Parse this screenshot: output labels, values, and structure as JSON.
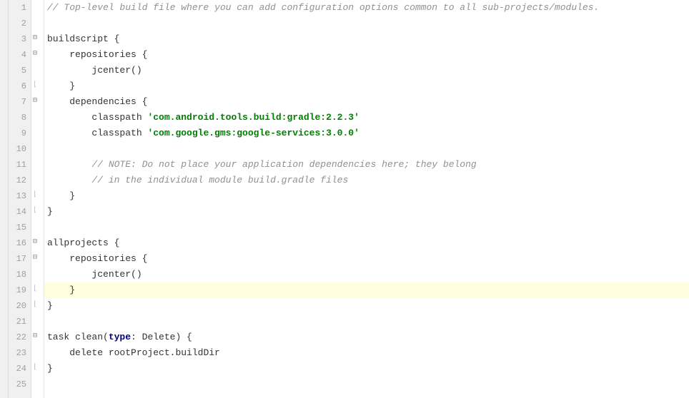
{
  "editor": {
    "highlighted_line": 19,
    "line_count": 25,
    "lines": [
      {
        "n": 1,
        "segs": [
          {
            "t": "// Top-level build file where you can add configuration options common to all sub-projects/modules.",
            "cls": "comment"
          }
        ],
        "indent": 0
      },
      {
        "n": 2,
        "segs": [],
        "indent": 0
      },
      {
        "n": 3,
        "segs": [
          {
            "t": "buildscript {",
            "cls": "ident"
          }
        ],
        "indent": 0,
        "fold": "open"
      },
      {
        "n": 4,
        "segs": [
          {
            "t": "repositories {",
            "cls": "ident"
          }
        ],
        "indent": 1,
        "fold": "open"
      },
      {
        "n": 5,
        "segs": [
          {
            "t": "jcenter()",
            "cls": "ident"
          }
        ],
        "indent": 2
      },
      {
        "n": 6,
        "segs": [
          {
            "t": "}",
            "cls": "ident"
          }
        ],
        "indent": 1,
        "fold": "close"
      },
      {
        "n": 7,
        "segs": [
          {
            "t": "dependencies {",
            "cls": "ident"
          }
        ],
        "indent": 1,
        "fold": "open"
      },
      {
        "n": 8,
        "segs": [
          {
            "t": "classpath ",
            "cls": "ident"
          },
          {
            "t": "'com.android.tools.build:gradle:2.2.3'",
            "cls": "string"
          }
        ],
        "indent": 2
      },
      {
        "n": 9,
        "segs": [
          {
            "t": "classpath ",
            "cls": "ident"
          },
          {
            "t": "'com.google.gms:google-services:3.0.0'",
            "cls": "string"
          }
        ],
        "indent": 2
      },
      {
        "n": 10,
        "segs": [],
        "indent": 0
      },
      {
        "n": 11,
        "segs": [
          {
            "t": "// NOTE: Do not place your application dependencies here; they belong",
            "cls": "comment"
          }
        ],
        "indent": 2
      },
      {
        "n": 12,
        "segs": [
          {
            "t": "// in the individual module build.gradle files",
            "cls": "comment"
          }
        ],
        "indent": 2
      },
      {
        "n": 13,
        "segs": [
          {
            "t": "}",
            "cls": "ident"
          }
        ],
        "indent": 1,
        "fold": "close"
      },
      {
        "n": 14,
        "segs": [
          {
            "t": "}",
            "cls": "ident"
          }
        ],
        "indent": 0,
        "fold": "close"
      },
      {
        "n": 15,
        "segs": [],
        "indent": 0
      },
      {
        "n": 16,
        "segs": [
          {
            "t": "allprojects {",
            "cls": "ident"
          }
        ],
        "indent": 0,
        "fold": "open"
      },
      {
        "n": 17,
        "segs": [
          {
            "t": "repositories {",
            "cls": "ident"
          }
        ],
        "indent": 1,
        "fold": "open"
      },
      {
        "n": 18,
        "segs": [
          {
            "t": "jcenter()",
            "cls": "ident"
          }
        ],
        "indent": 2
      },
      {
        "n": 19,
        "segs": [
          {
            "t": "}",
            "cls": "ident"
          }
        ],
        "indent": 1,
        "fold": "close"
      },
      {
        "n": 20,
        "segs": [
          {
            "t": "}",
            "cls": "ident"
          }
        ],
        "indent": 0,
        "fold": "close"
      },
      {
        "n": 21,
        "segs": [],
        "indent": 0
      },
      {
        "n": 22,
        "segs": [
          {
            "t": "task clean(",
            "cls": "ident"
          },
          {
            "t": "type",
            "cls": "keyword"
          },
          {
            "t": ": Delete) {",
            "cls": "ident"
          }
        ],
        "indent": 0,
        "fold": "open"
      },
      {
        "n": 23,
        "segs": [
          {
            "t": "delete rootProject.buildDir",
            "cls": "ident"
          }
        ],
        "indent": 1
      },
      {
        "n": 24,
        "segs": [
          {
            "t": "}",
            "cls": "ident"
          }
        ],
        "indent": 0,
        "fold": "close"
      },
      {
        "n": 25,
        "segs": [],
        "indent": 0
      }
    ]
  }
}
